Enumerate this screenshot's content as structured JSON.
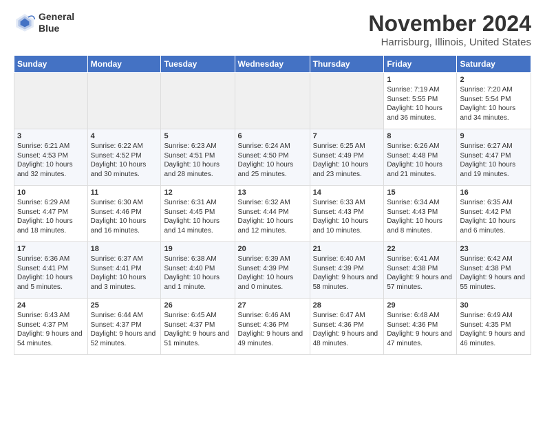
{
  "header": {
    "logo_line1": "General",
    "logo_line2": "Blue",
    "month": "November 2024",
    "location": "Harrisburg, Illinois, United States"
  },
  "days_of_week": [
    "Sunday",
    "Monday",
    "Tuesday",
    "Wednesday",
    "Thursday",
    "Friday",
    "Saturday"
  ],
  "weeks": [
    [
      {
        "day": "",
        "empty": true
      },
      {
        "day": "",
        "empty": true
      },
      {
        "day": "",
        "empty": true
      },
      {
        "day": "",
        "empty": true
      },
      {
        "day": "",
        "empty": true
      },
      {
        "day": "1",
        "sunrise": "Sunrise: 7:19 AM",
        "sunset": "Sunset: 5:55 PM",
        "daylight": "Daylight: 10 hours and 36 minutes."
      },
      {
        "day": "2",
        "sunrise": "Sunrise: 7:20 AM",
        "sunset": "Sunset: 5:54 PM",
        "daylight": "Daylight: 10 hours and 34 minutes."
      }
    ],
    [
      {
        "day": "3",
        "sunrise": "Sunrise: 6:21 AM",
        "sunset": "Sunset: 4:53 PM",
        "daylight": "Daylight: 10 hours and 32 minutes."
      },
      {
        "day": "4",
        "sunrise": "Sunrise: 6:22 AM",
        "sunset": "Sunset: 4:52 PM",
        "daylight": "Daylight: 10 hours and 30 minutes."
      },
      {
        "day": "5",
        "sunrise": "Sunrise: 6:23 AM",
        "sunset": "Sunset: 4:51 PM",
        "daylight": "Daylight: 10 hours and 28 minutes."
      },
      {
        "day": "6",
        "sunrise": "Sunrise: 6:24 AM",
        "sunset": "Sunset: 4:50 PM",
        "daylight": "Daylight: 10 hours and 25 minutes."
      },
      {
        "day": "7",
        "sunrise": "Sunrise: 6:25 AM",
        "sunset": "Sunset: 4:49 PM",
        "daylight": "Daylight: 10 hours and 23 minutes."
      },
      {
        "day": "8",
        "sunrise": "Sunrise: 6:26 AM",
        "sunset": "Sunset: 4:48 PM",
        "daylight": "Daylight: 10 hours and 21 minutes."
      },
      {
        "day": "9",
        "sunrise": "Sunrise: 6:27 AM",
        "sunset": "Sunset: 4:47 PM",
        "daylight": "Daylight: 10 hours and 19 minutes."
      }
    ],
    [
      {
        "day": "10",
        "sunrise": "Sunrise: 6:29 AM",
        "sunset": "Sunset: 4:47 PM",
        "daylight": "Daylight: 10 hours and 18 minutes."
      },
      {
        "day": "11",
        "sunrise": "Sunrise: 6:30 AM",
        "sunset": "Sunset: 4:46 PM",
        "daylight": "Daylight: 10 hours and 16 minutes."
      },
      {
        "day": "12",
        "sunrise": "Sunrise: 6:31 AM",
        "sunset": "Sunset: 4:45 PM",
        "daylight": "Daylight: 10 hours and 14 minutes."
      },
      {
        "day": "13",
        "sunrise": "Sunrise: 6:32 AM",
        "sunset": "Sunset: 4:44 PM",
        "daylight": "Daylight: 10 hours and 12 minutes."
      },
      {
        "day": "14",
        "sunrise": "Sunrise: 6:33 AM",
        "sunset": "Sunset: 4:43 PM",
        "daylight": "Daylight: 10 hours and 10 minutes."
      },
      {
        "day": "15",
        "sunrise": "Sunrise: 6:34 AM",
        "sunset": "Sunset: 4:43 PM",
        "daylight": "Daylight: 10 hours and 8 minutes."
      },
      {
        "day": "16",
        "sunrise": "Sunrise: 6:35 AM",
        "sunset": "Sunset: 4:42 PM",
        "daylight": "Daylight: 10 hours and 6 minutes."
      }
    ],
    [
      {
        "day": "17",
        "sunrise": "Sunrise: 6:36 AM",
        "sunset": "Sunset: 4:41 PM",
        "daylight": "Daylight: 10 hours and 5 minutes."
      },
      {
        "day": "18",
        "sunrise": "Sunrise: 6:37 AM",
        "sunset": "Sunset: 4:41 PM",
        "daylight": "Daylight: 10 hours and 3 minutes."
      },
      {
        "day": "19",
        "sunrise": "Sunrise: 6:38 AM",
        "sunset": "Sunset: 4:40 PM",
        "daylight": "Daylight: 10 hours and 1 minute."
      },
      {
        "day": "20",
        "sunrise": "Sunrise: 6:39 AM",
        "sunset": "Sunset: 4:39 PM",
        "daylight": "Daylight: 10 hours and 0 minutes."
      },
      {
        "day": "21",
        "sunrise": "Sunrise: 6:40 AM",
        "sunset": "Sunset: 4:39 PM",
        "daylight": "Daylight: 9 hours and 58 minutes."
      },
      {
        "day": "22",
        "sunrise": "Sunrise: 6:41 AM",
        "sunset": "Sunset: 4:38 PM",
        "daylight": "Daylight: 9 hours and 57 minutes."
      },
      {
        "day": "23",
        "sunrise": "Sunrise: 6:42 AM",
        "sunset": "Sunset: 4:38 PM",
        "daylight": "Daylight: 9 hours and 55 minutes."
      }
    ],
    [
      {
        "day": "24",
        "sunrise": "Sunrise: 6:43 AM",
        "sunset": "Sunset: 4:37 PM",
        "daylight": "Daylight: 9 hours and 54 minutes."
      },
      {
        "day": "25",
        "sunrise": "Sunrise: 6:44 AM",
        "sunset": "Sunset: 4:37 PM",
        "daylight": "Daylight: 9 hours and 52 minutes."
      },
      {
        "day": "26",
        "sunrise": "Sunrise: 6:45 AM",
        "sunset": "Sunset: 4:37 PM",
        "daylight": "Daylight: 9 hours and 51 minutes."
      },
      {
        "day": "27",
        "sunrise": "Sunrise: 6:46 AM",
        "sunset": "Sunset: 4:36 PM",
        "daylight": "Daylight: 9 hours and 49 minutes."
      },
      {
        "day": "28",
        "sunrise": "Sunrise: 6:47 AM",
        "sunset": "Sunset: 4:36 PM",
        "daylight": "Daylight: 9 hours and 48 minutes."
      },
      {
        "day": "29",
        "sunrise": "Sunrise: 6:48 AM",
        "sunset": "Sunset: 4:36 PM",
        "daylight": "Daylight: 9 hours and 47 minutes."
      },
      {
        "day": "30",
        "sunrise": "Sunrise: 6:49 AM",
        "sunset": "Sunset: 4:35 PM",
        "daylight": "Daylight: 9 hours and 46 minutes."
      }
    ]
  ]
}
